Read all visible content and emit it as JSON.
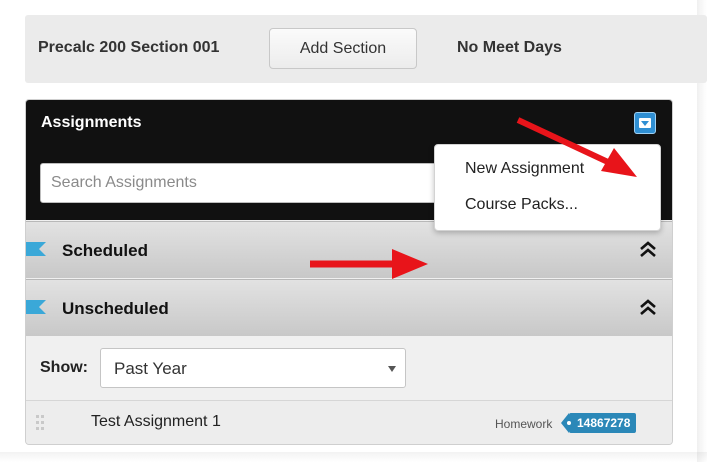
{
  "section": {
    "title": "Precalc 200 Section 001",
    "add_button_label": "Add Section",
    "meet_days": "No Meet Days"
  },
  "panel": {
    "title": "Assignments",
    "menu_button_icon": "dropdown-caret-icon",
    "search_placeholder": "Search Assignments",
    "groups": [
      {
        "label": "Scheduled",
        "icon": "flag-icon",
        "toggle_icon": "double-chevron-up-icon"
      },
      {
        "label": "Unscheduled",
        "icon": "flag-icon",
        "toggle_icon": "double-chevron-up-icon"
      }
    ],
    "show": {
      "label": "Show:",
      "selected": "Past Year"
    },
    "assignments": [
      {
        "title": "Test Assignment 1",
        "type": "Homework",
        "id": "14867278"
      }
    ]
  },
  "dropdown_menu": {
    "items": [
      "New Assignment",
      "Course Packs..."
    ]
  },
  "colors": {
    "panel_header": "#111111",
    "accent_blue": "#2f8fd3",
    "flag_blue": "#3aa8d8",
    "id_badge": "#2b88b8",
    "annotation_arrow": "#e8141a"
  }
}
